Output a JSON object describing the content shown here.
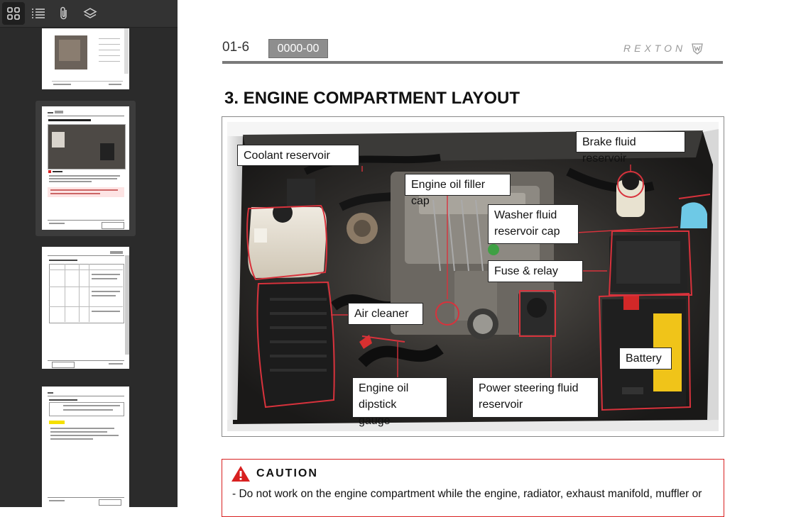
{
  "toolbar": {
    "icons": [
      "thumbnails-grid-icon",
      "outline-list-icon",
      "attachment-paperclip-icon",
      "layers-icon"
    ]
  },
  "header": {
    "page_number": "01-6",
    "section_code": "0000-00",
    "brand": "REXTON"
  },
  "title": "3. ENGINE COMPARTMENT LAYOUT",
  "labels": {
    "coolant": "Coolant reservoir",
    "brake": "Brake fluid reservoir",
    "oil_filler": "Engine oil filler cap",
    "washer_1": "Washer fluid",
    "washer_2": "reservoir cap",
    "fuse": "Fuse & relay",
    "air_cleaner": "Air cleaner",
    "battery": "Battery",
    "dipstick_1": "Engine oil dipstick",
    "dipstick_2": "gauge",
    "ps_1": "Power steering fluid",
    "ps_2": "reservoir"
  },
  "caution": {
    "title": "CAUTION",
    "text": "-  Do not work on the engine compartment while the engine, radiator, exhaust manifold, muffler or"
  },
  "colors": {
    "sidebar_bg": "#2b2b2b",
    "badge_bg": "#8e8e8e",
    "caution_red": "#d82020",
    "outline_red": "#d8323c"
  }
}
